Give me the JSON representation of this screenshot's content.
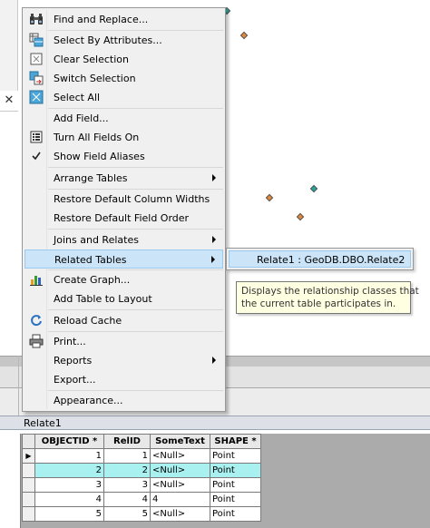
{
  "menu": {
    "items": [
      {
        "label": "Find and Replace...",
        "icon": "binoculars-icon"
      },
      {
        "label": "Select By Attributes...",
        "icon": "select-attributes-icon"
      },
      {
        "label": "Clear Selection",
        "icon": "clear-selection-icon"
      },
      {
        "label": "Switch Selection",
        "icon": "switch-selection-icon"
      },
      {
        "label": "Select All",
        "icon": "select-all-icon"
      },
      {
        "label": "Add Field...",
        "icon": ""
      },
      {
        "label": "Turn All Fields On",
        "icon": "fields-list-icon"
      },
      {
        "label": "Show Field Aliases",
        "icon": "checkmark-icon"
      },
      {
        "label": "Arrange Tables",
        "icon": ""
      },
      {
        "label": "Restore Default Column Widths",
        "icon": ""
      },
      {
        "label": "Restore Default Field Order",
        "icon": ""
      },
      {
        "label": "Joins and Relates",
        "icon": ""
      },
      {
        "label": "Related Tables",
        "icon": ""
      },
      {
        "label": "Create Graph...",
        "icon": "bar-chart-icon"
      },
      {
        "label": "Add Table to Layout",
        "icon": ""
      },
      {
        "label": "Reload Cache",
        "icon": "reload-icon"
      },
      {
        "label": "Print...",
        "icon": "printer-icon"
      },
      {
        "label": "Reports",
        "icon": ""
      },
      {
        "label": "Export...",
        "icon": ""
      },
      {
        "label": "Appearance...",
        "icon": ""
      }
    ]
  },
  "submenu": {
    "item": "Relate1 : GeoDB.DBO.Relate2"
  },
  "tooltip": {
    "line1": "Displays the relationship classes that",
    "line2": "the current table participates in."
  },
  "close_glyph": "✕",
  "table": {
    "title": "Relate1",
    "columns": [
      "OBJECTID *",
      "RelID",
      "SomeText",
      "SHAPE *"
    ],
    "rows": [
      {
        "marker": "▶",
        "cells": [
          "1",
          "1",
          "<Null>",
          "Point"
        ]
      },
      {
        "marker": "",
        "cells": [
          "2",
          "2",
          "<Null>",
          "Point"
        ]
      },
      {
        "marker": "",
        "cells": [
          "3",
          "3",
          "<Null>",
          "Point"
        ]
      },
      {
        "marker": "",
        "cells": [
          "4",
          "4",
          "4",
          "Point"
        ]
      },
      {
        "marker": "",
        "cells": [
          "5",
          "5",
          "<Null>",
          "Point"
        ]
      }
    ]
  },
  "colors": {
    "highlight_row": "#a9f0f0",
    "menu_active": "#cce4f7",
    "tooltip_bg": "#ffffe1"
  }
}
